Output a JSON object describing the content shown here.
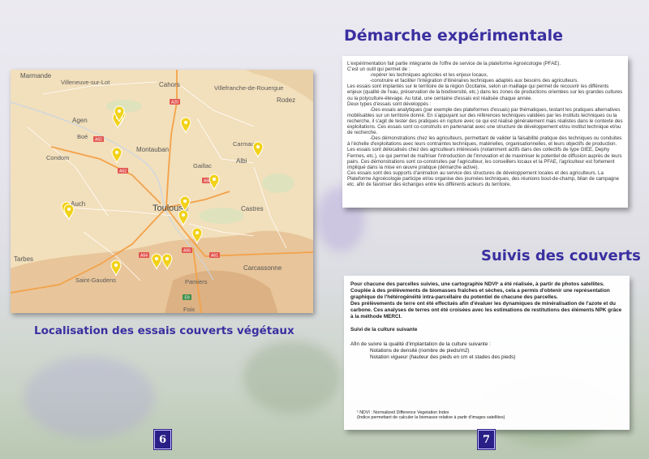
{
  "right_page": {
    "title": "Démarche expérimentale",
    "intro": [
      "L'expérimentation fait partie intégrante de l'offre de service de la plateforme Agroécologie (PFAE).",
      "C'est un outil qui permet de :"
    ],
    "bullets": [
      "-repérer les techniques agricoles et les enjeux locaux,",
      "-construire et faciliter l'intégration d'itinéraires techniques adaptés aux besoins des agriculteurs."
    ],
    "body_1": "Les essais sont implantés sur le territoire de la région Occitanie, selon un maillage qui permet de recouvrir les différents enjeux (qualité de l'eau, préservation de la biodiversité, etc.) dans les zones de productions orientées sur les grandes cultures ou la polyculture-élevage. Au total, une centaine d'essais est réalisée chaque année.",
    "types_heading": "Deux types d'essais sont développés :",
    "type_1": "-Des essais analytiques (par exemple des plateformes d'essais) par thématiques, testant les pratiques alternatives mobilisables sur un territoire donné. En s'appuyant sur des références techniques validées par les instituts techniques ou la recherche, il s'agit de tester des pratiques en rupture avec ce qui est réalisé généralement mais réalistes dans le contexte des exploitations. Ces essais sont co-construits en partenariat avec une structure de développement et/ou institut technique et/ou de recherche.",
    "type_2": "-Des démonstrations chez les agriculteurs, permettant de valider la faisabilité pratique des techniques ou conduites à l'échelle d'exploitations avec leurs contraintes techniques, matérielles, organisationnelles, et leurs objectifs de production. Les essais sont délocalisés chez des agriculteurs intéressés (notamment actifs dans des collectifs de type GIEE, Dephy Fermes, etc.), ce qui permet de maîtriser l'introduction de l'innovation et de maximiser le potentiel de diffusion auprès de leurs pairs. Ces démonstrations sont co-construites par l'agriculteur, les conseillers locaux et la PFAE, l'agriculteur est fortement impliqué dans la mise en œuvre pratique (démarche active).",
    "body_2": "Ces essais sont des supports d'animation au service des structures de développement locales et des agriculteurs. La Plateforme Agroécologie participe et/ou organise des journées techniques, des réunions bout-de-champ, bilan de campagne etc. afin de favoriser des échanges entre les différents acteurs du territoire.",
    "section_title": "Suivis des couverts",
    "suivi_1": "Pour chacune des parcelles suivies, une cartographie NDVI¹ a été réalisée, à partir de photos satellites. Couplée à des prélèvements de biomasses fraîches et sèches, cela a permis d'obtenir une représentation graphique de l'hétérogénéité intra-parcellaire du potentiel de chacune des parcelles.",
    "suivi_2": "Des prélèvements de terre ont été effectués afin d'évaluer les dynamiques de minéralisation de l'azote et du carbone. Ces analyses de terres ont été croisées avec les estimations de restitutions des éléments NPK grâce à la méthode MERCI.",
    "culture_heading": "Suivi de la culture suivante",
    "culture_intro": "Afin de suivre la qualité d'implantation de la culture suivante :",
    "culture_items": [
      "Notations de densité (nombre de pieds/m2)",
      "Notation vigueur (hauteur des pieds en cm et stades des pieds)"
    ],
    "footnote_1": "¹ NDVI : Normalized Difference Vegetation Index",
    "footnote_2": "(Indice permettant de calculer la biomasse relative à partir d'images satellites)",
    "page_number": "7"
  },
  "left_page": {
    "map_caption": "Localisation des essais couverts végétaux",
    "page_number": "6",
    "map": {
      "places": [
        "Marmande",
        "Villeneuve-sur-Lot",
        "Cahors",
        "Villefranche-de-Rouergue",
        "Rodez",
        "Agen",
        "Boé",
        "Condom",
        "Montauban",
        "Gaillac",
        "Carmaux",
        "Albi",
        "Auch",
        "Toulouse",
        "Castres",
        "Tarbes",
        "Saint-Gaudens",
        "Pamiers",
        "Carcassonne",
        "Foix"
      ],
      "roads": [
        "A20",
        "A62",
        "A62",
        "A68",
        "A64",
        "A66",
        "A61",
        "E9"
      ],
      "marker_icon": "map-pin-icon",
      "marker_color": "#f2d21a"
    }
  }
}
